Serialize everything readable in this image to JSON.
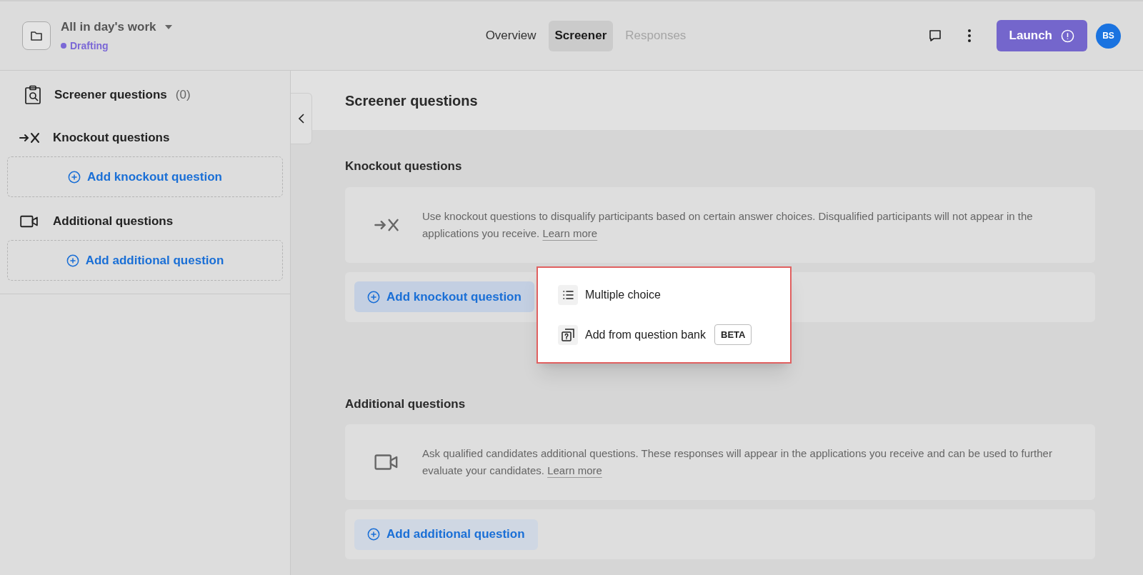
{
  "project": {
    "title": "All in day's work",
    "status": {
      "label": "Drafting",
      "color": "#7b68d6"
    }
  },
  "tabs": [
    {
      "label": "Overview",
      "selected": false,
      "disabled": false
    },
    {
      "label": "Screener",
      "selected": true,
      "disabled": false
    },
    {
      "label": "Responses",
      "selected": false,
      "disabled": true
    }
  ],
  "launch_button": "Launch",
  "avatar": "BS",
  "sidebar": {
    "title": "Screener questions",
    "count": "(0)",
    "sections": [
      {
        "kind": "knockout",
        "label": "Knockout questions",
        "add_label": "Add knockout question"
      },
      {
        "kind": "additional",
        "label": "Additional questions",
        "add_label": "Add additional question"
      }
    ]
  },
  "main": {
    "title": "Screener questions",
    "sections": [
      {
        "kind": "knockout",
        "heading": "Knockout questions",
        "description": "Use knockout questions to disqualify participants based on certain answer choices. Disqualified participants will not appear in the applications you receive.",
        "link": "Learn more",
        "add_label": "Add knockout question",
        "menu_open": true
      },
      {
        "kind": "additional",
        "heading": "Additional questions",
        "description": "Ask qualified candidates additional questions. These responses will appear in the applications you receive and can be used to further evaluate your candidates.",
        "link": "Learn more",
        "add_label": "Add additional question",
        "menu_open": false
      }
    ]
  },
  "menu": {
    "items": [
      {
        "kind": "list",
        "label": "Multiple choice"
      },
      {
        "kind": "bank",
        "label": "Add from question bank",
        "badge": "BETA"
      }
    ]
  }
}
